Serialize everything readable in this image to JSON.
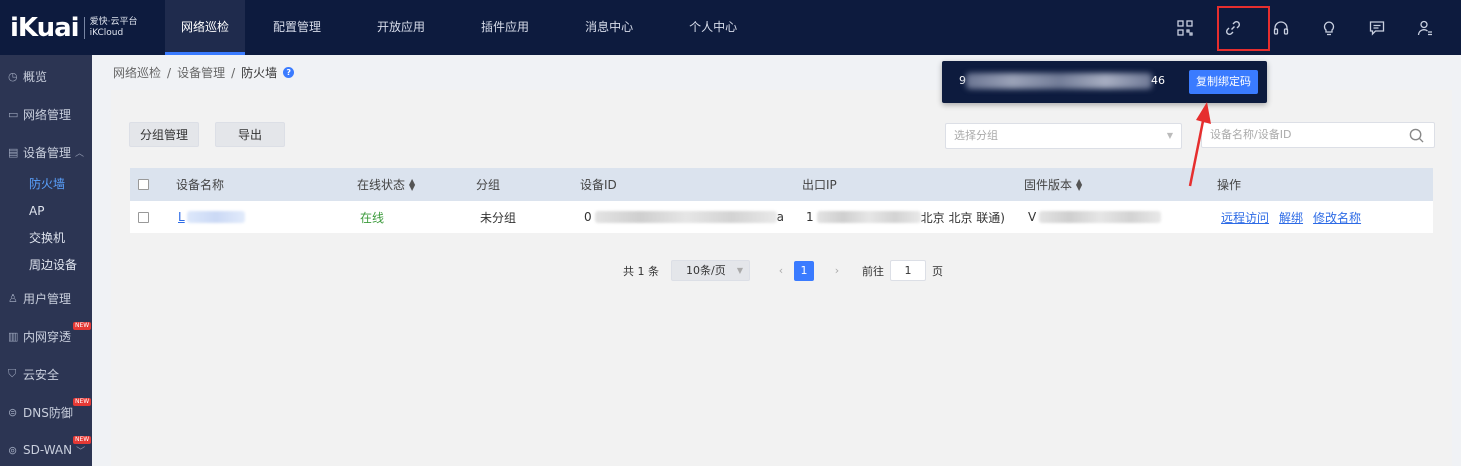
{
  "header": {
    "logo": "iKuai",
    "logo_sub_cn": "爱快·云平台",
    "logo_sub_en": "iKCloud",
    "nav": [
      "网络巡检",
      "配置管理",
      "开放应用",
      "插件应用",
      "消息中心",
      "个人中心"
    ],
    "active_nav": "网络巡检",
    "icons": [
      "qr-scan-icon",
      "link-icon",
      "headset-icon",
      "lightbulb-icon",
      "message-icon",
      "user-settings-icon"
    ],
    "highlight_color": "#e62e2e"
  },
  "sidebar": {
    "items": [
      {
        "label": "概览",
        "icon": "dashboard-icon"
      },
      {
        "label": "网络管理",
        "icon": "monitor-icon"
      },
      {
        "label": "设备管理",
        "icon": "device-icon"
      },
      {
        "label": "用户管理",
        "icon": "user-icon"
      },
      {
        "label": "内网穿透",
        "icon": "tunnel-icon",
        "badge": "NEW"
      },
      {
        "label": "云安全",
        "icon": "shield-icon"
      },
      {
        "label": "DNS防御",
        "icon": "dns-icon",
        "badge": "NEW"
      },
      {
        "label": "SD-WAN",
        "icon": "sdwan-icon",
        "badge": "NEW"
      }
    ],
    "sub_items": [
      "防火墙",
      "AP",
      "交换机",
      "周边设备"
    ],
    "active_sub": "防火墙"
  },
  "breadcrumb": [
    "网络巡检",
    "设备管理",
    "防火墙"
  ],
  "separator": "/",
  "toolbar": {
    "group_manage": "分组管理",
    "export": "导出",
    "group_select_placeholder": "选择分组",
    "search_placeholder": "设备名称/设备ID"
  },
  "table": {
    "headers": [
      "设备名称",
      "在线状态",
      "分组",
      "设备ID",
      "出口IP",
      "固件版本",
      "操作"
    ],
    "rows": [
      {
        "name_prefix": "L",
        "status": "在线",
        "group": "未分组",
        "id_prefix": "0",
        "id_suffix": "a",
        "ip_prefix": "1",
        "ip_suffix": "北京 北京 联通)",
        "fw_prefix": "V",
        "ops": [
          "远程访问",
          "解绑",
          "修改名称"
        ]
      }
    ]
  },
  "pagination": {
    "total": "共 1 条",
    "page_size": "10条/页",
    "current_page": "1",
    "goto_label": "前往",
    "goto_value": "1",
    "page_suffix": "页"
  },
  "popover": {
    "code_start": "9",
    "code_end": "46",
    "copy_button": "复制绑定码"
  }
}
